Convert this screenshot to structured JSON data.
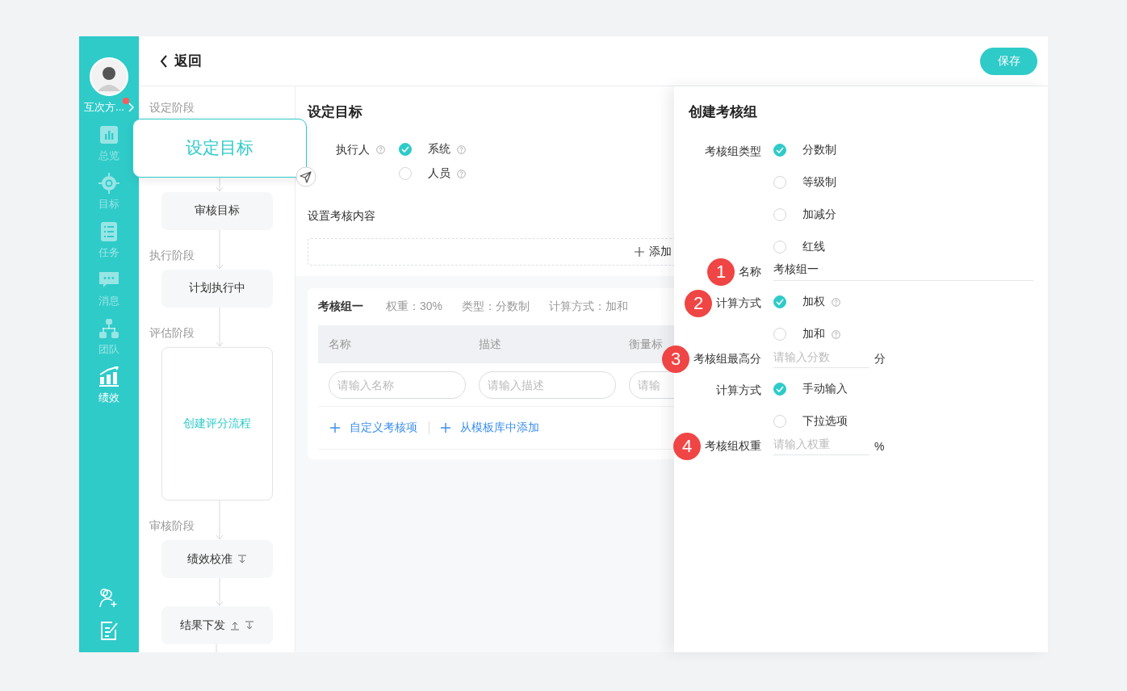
{
  "sidebar": {
    "user_name": "互次方...",
    "has_notification": true,
    "nav_items": [
      {
        "label": "总览",
        "kind": "overview",
        "selected": false
      },
      {
        "label": "目标",
        "kind": "goals",
        "selected": false
      },
      {
        "label": "任务",
        "kind": "tasks",
        "selected": false
      },
      {
        "label": "消息",
        "kind": "messages",
        "selected": false
      },
      {
        "label": "团队",
        "kind": "team",
        "selected": false
      },
      {
        "label": "绩效",
        "kind": "performance",
        "selected": true
      }
    ]
  },
  "header": {
    "back_label": "返回",
    "save_button": "保存"
  },
  "flow": [
    {
      "stage": "设定阶段",
      "nodes": [
        {
          "label": "设定目标",
          "kind": "focus"
        },
        {
          "label": "审核目标",
          "kind": "step"
        }
      ]
    },
    {
      "stage": "执行阶段",
      "nodes": [
        {
          "label": "计划执行中",
          "kind": "step"
        }
      ]
    },
    {
      "stage": "评估阶段",
      "nodes": [
        {
          "label": "创建评分流程",
          "kind": "pending"
        }
      ]
    },
    {
      "stage": "审核阶段",
      "nodes": [
        {
          "label": "绩效校准",
          "kind": "step",
          "move_down": true
        },
        {
          "label": "结果下发",
          "kind": "step",
          "move_up": true,
          "move_down": true
        }
      ]
    }
  ],
  "middle": {
    "title": "设定目标",
    "executor": {
      "label": "执行人",
      "help": true,
      "options": [
        {
          "label": "系统",
          "selected": true,
          "help": true
        },
        {
          "label": "人员",
          "selected": false,
          "help": true
        }
      ]
    },
    "content_label": "设置考核内容",
    "add_button": "添加",
    "group": {
      "name": "考核组一",
      "weight": "权重：30%",
      "type": "类型：分数制",
      "method": "计算方式：加和",
      "columns": [
        "名称",
        "描述",
        "衡量标"
      ],
      "inputs": [
        {
          "placeholder": "请输入名称"
        },
        {
          "placeholder": "请输入描述"
        },
        {
          "placeholder": "请输"
        }
      ],
      "links": [
        "自定义考核项",
        "从模板库中添加"
      ]
    }
  },
  "drawer": {
    "title": "创建考核组",
    "fields": [
      {
        "kind": "radio",
        "label": "考核组类型",
        "options": [
          {
            "label": "分数制",
            "selected": true
          },
          {
            "label": "等级制",
            "selected": false
          },
          {
            "label": "加减分",
            "selected": false
          },
          {
            "label": "红线",
            "selected": false
          }
        ]
      },
      {
        "kind": "text",
        "label": "名称",
        "badge": "1",
        "value": "考核组一"
      },
      {
        "kind": "radio",
        "label": "计算方式",
        "badge": "2",
        "options": [
          {
            "label": "加权",
            "selected": true,
            "help": true
          },
          {
            "label": "加和",
            "selected": false,
            "help": true
          }
        ]
      },
      {
        "kind": "input",
        "label": "考核组最高分",
        "badge": "3",
        "placeholder": "请输入分数",
        "unit": "分"
      },
      {
        "kind": "radio",
        "label": "计算方式",
        "options": [
          {
            "label": "手动输入",
            "selected": true
          },
          {
            "label": "下拉选项",
            "selected": false
          }
        ]
      },
      {
        "kind": "input",
        "label": "考核组权重",
        "badge": "4",
        "placeholder": "请输入权重",
        "unit": "%"
      }
    ]
  }
}
